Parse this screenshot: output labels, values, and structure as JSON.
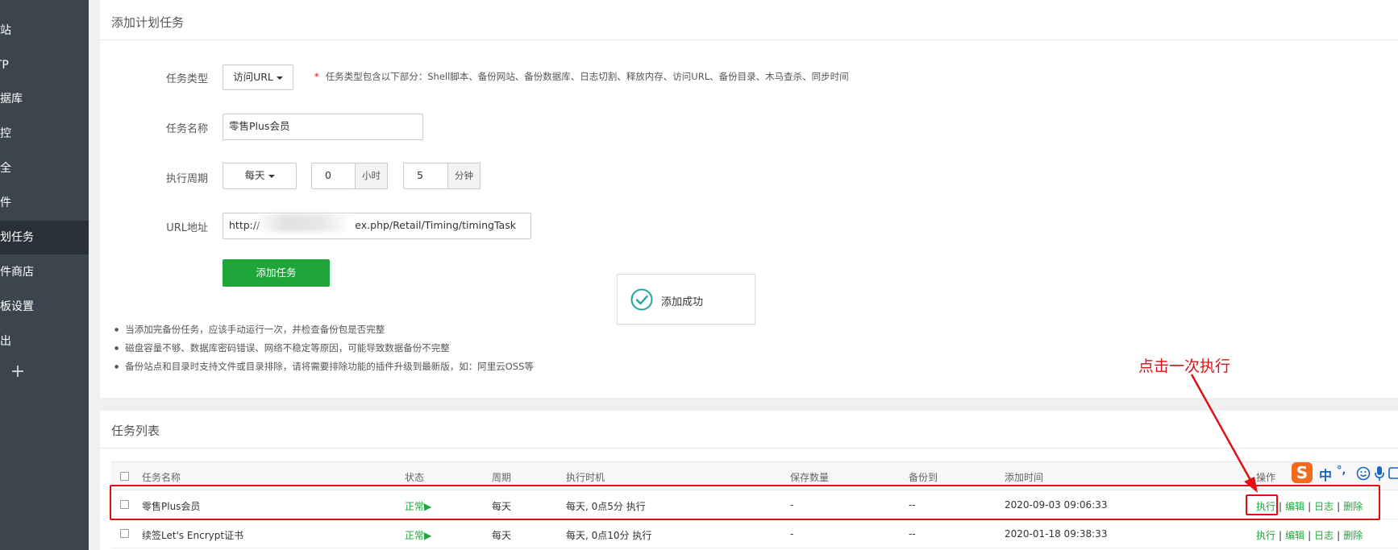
{
  "sidebar": {
    "items": [
      {
        "label": "网站"
      },
      {
        "label": "FTP"
      },
      {
        "label": "数据库"
      },
      {
        "label": "监控"
      },
      {
        "label": "安全"
      },
      {
        "label": "文件"
      },
      {
        "label": "计划任务"
      },
      {
        "label": "软件商店"
      },
      {
        "label": "面板设置"
      },
      {
        "label": "退出"
      }
    ],
    "active_index": 6,
    "plus_label": "+"
  },
  "add_task": {
    "title": "添加计划任务",
    "task_type_label": "任务类型",
    "task_type_value": "访问URL",
    "hint_star": "*",
    "hint_text": "任务类型包含以下部分：Shell脚本、备份网站、备份数据库、日志切割、释放内存、访问URL、备份目录、木马查杀、同步时间",
    "task_name_label": "任务名称",
    "task_name_value": "零售Plus会员",
    "period_label": "执行周期",
    "period_value": "每天",
    "hour_value": "0",
    "hour_unit": "小时",
    "minute_value": "5",
    "minute_unit": "分钟",
    "url_label": "URL地址",
    "url_value_prefix": "http://",
    "url_value_suffix": "ex.php/Retail/Timing/timingTask",
    "submit_label": "添加任务",
    "bullets": [
      "当添加完备份任务，应该手动运行一次，并检查备份包是否完整",
      "磁盘容量不够、数据库密码错误、网络不稳定等原因，可能导致数据备份不完整",
      "备份站点和目录时支持文件或目录排除，请将需要排除功能的插件升级到最新版，如：阿里云OSS等"
    ]
  },
  "toast": {
    "text": "添加成功"
  },
  "task_list": {
    "title": "任务列表",
    "columns": [
      "任务名称",
      "状态",
      "周期",
      "执行时机",
      "保存数量",
      "备份到",
      "添加时间",
      "操作"
    ],
    "rows": [
      {
        "name": "零售Plus会员",
        "status": "正常▶",
        "period": "每天",
        "timing": "每天, 0点5分 执行",
        "keep": "-",
        "backup_to": "--",
        "added": "2020-09-03 09:06:33"
      },
      {
        "name": "续签Let's Encrypt证书",
        "status": "正常▶",
        "period": "每天",
        "timing": "每天, 0点10分 执行",
        "keep": "-",
        "backup_to": "--",
        "added": "2020-01-18 09:38:33"
      }
    ],
    "ops": {
      "run": "执行",
      "edit": "编辑",
      "log": "日志",
      "delete": "删除",
      "sep": "|"
    }
  },
  "annotation": {
    "text": "点击一次执行",
    "color": "#e01010"
  },
  "ime": {
    "logo": "S",
    "lang": "中",
    "punct": "°,"
  },
  "colors": {
    "accent": "#20a53a",
    "sidebar_bg": "#3c444d",
    "annotation": "#e01010"
  }
}
